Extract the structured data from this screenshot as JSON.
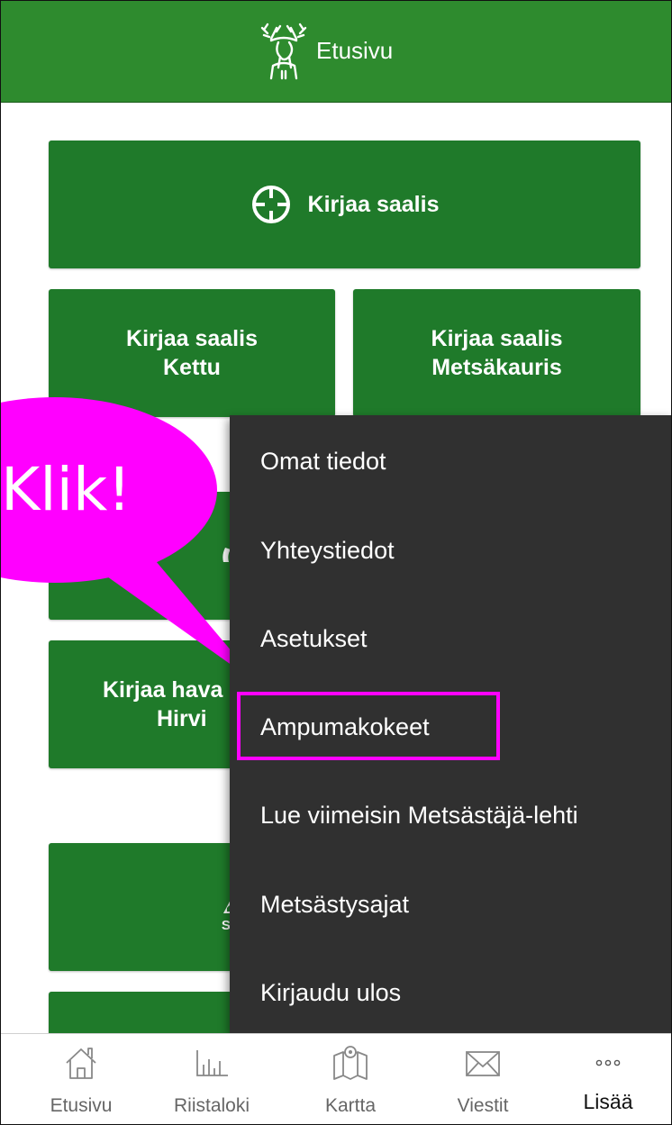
{
  "header": {
    "title": "Etusivu"
  },
  "tiles": {
    "record_catch": "Kirjaa saalis",
    "kettu_line1": "Kirjaa saalis",
    "kettu_line2": "Kettu",
    "metsa_line1": "Kirjaa saalis",
    "metsa_line2": "Metsäkauris",
    "hirvi_line1": "Kirjaa hava",
    "hirvi_line2": "Hirvi",
    "srva_label": "SRVA"
  },
  "menu": {
    "items": [
      {
        "label": "Omat tiedot"
      },
      {
        "label": "Yhteystiedot"
      },
      {
        "label": "Asetukset"
      },
      {
        "label": "Ampumakokeet"
      },
      {
        "label": "Lue viimeisin Metsästäjä-lehti"
      },
      {
        "label": "Metsästysajat"
      },
      {
        "label": "Kirjaudu ulos"
      }
    ],
    "highlighted_index": 3
  },
  "callout": {
    "text": "Klik!",
    "color": "#ff00ff"
  },
  "bottom_nav": {
    "items": [
      {
        "label": "Etusivu",
        "icon": "home-icon"
      },
      {
        "label": "Riistaloki",
        "icon": "bar-chart-icon"
      },
      {
        "label": "Kartta",
        "icon": "map-icon"
      },
      {
        "label": "Viestit",
        "icon": "mail-icon"
      },
      {
        "label": "Lisää",
        "icon": "more-icon"
      }
    ],
    "active_index": 4
  },
  "colors": {
    "header_green": "#2e8b2e",
    "tile_green": "#1f7a2a",
    "menu_bg": "#303030",
    "highlight": "#ff00ff"
  }
}
